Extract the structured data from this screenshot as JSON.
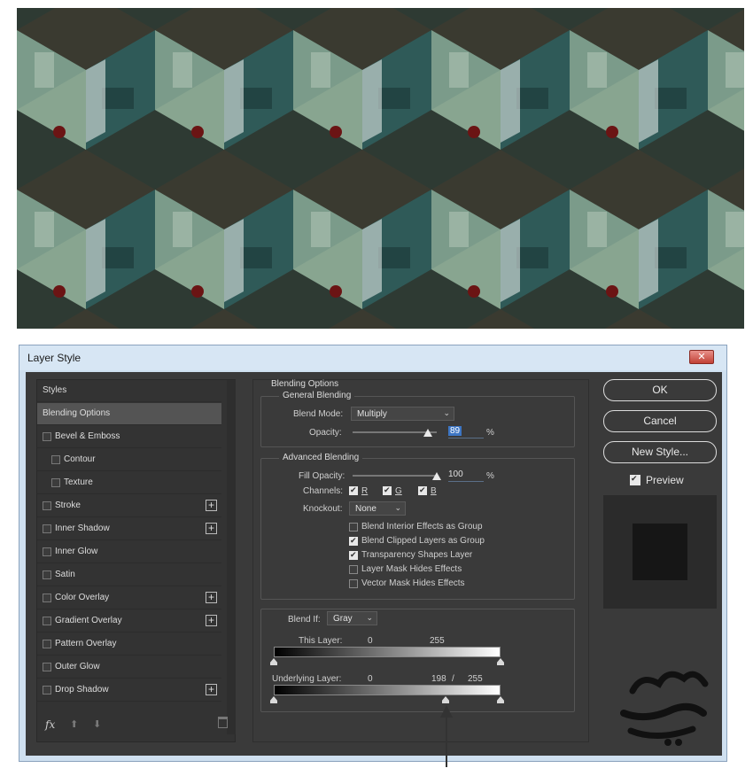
{
  "dialog": {
    "title": "Layer Style",
    "close_glyph": "✕"
  },
  "styles_list": {
    "items": [
      {
        "label": "Styles",
        "checkbox": false,
        "plus": false,
        "active": false,
        "indent": false
      },
      {
        "label": "Blending Options",
        "checkbox": false,
        "plus": false,
        "active": true,
        "indent": false
      },
      {
        "label": "Bevel & Emboss",
        "checkbox": true,
        "plus": false,
        "active": false,
        "indent": false
      },
      {
        "label": "Contour",
        "checkbox": true,
        "plus": false,
        "active": false,
        "indent": true
      },
      {
        "label": "Texture",
        "checkbox": true,
        "plus": false,
        "active": false,
        "indent": true
      },
      {
        "label": "Stroke",
        "checkbox": true,
        "plus": true,
        "active": false,
        "indent": false
      },
      {
        "label": "Inner Shadow",
        "checkbox": true,
        "plus": true,
        "active": false,
        "indent": false
      },
      {
        "label": "Inner Glow",
        "checkbox": true,
        "plus": false,
        "active": false,
        "indent": false
      },
      {
        "label": "Satin",
        "checkbox": true,
        "plus": false,
        "active": false,
        "indent": false
      },
      {
        "label": "Color Overlay",
        "checkbox": true,
        "plus": true,
        "active": false,
        "indent": false
      },
      {
        "label": "Gradient Overlay",
        "checkbox": true,
        "plus": true,
        "active": false,
        "indent": false
      },
      {
        "label": "Pattern Overlay",
        "checkbox": true,
        "plus": false,
        "active": false,
        "indent": false
      },
      {
        "label": "Outer Glow",
        "checkbox": true,
        "plus": false,
        "active": false,
        "indent": false
      },
      {
        "label": "Drop Shadow",
        "checkbox": true,
        "plus": true,
        "active": false,
        "indent": false
      }
    ],
    "footer": {
      "fx": "fx",
      "up": "⬆",
      "down": "⬇"
    }
  },
  "blending": {
    "section_title": "Blending Options",
    "general_title": "General Blending",
    "blend_mode_label": "Blend Mode:",
    "blend_mode_value": "Multiply",
    "opacity_label": "Opacity:",
    "opacity_value": "89",
    "opacity_fraction": 0.89,
    "percent": "%",
    "advanced_title": "Advanced Blending",
    "fill_opacity_label": "Fill Opacity:",
    "fill_opacity_value": "100",
    "fill_opacity_fraction": 1.0,
    "channels_label": "Channels:",
    "channels": [
      {
        "label": "R",
        "checked": true
      },
      {
        "label": "G",
        "checked": true
      },
      {
        "label": "B",
        "checked": true
      }
    ],
    "knockout_label": "Knockout:",
    "knockout_value": "None",
    "options": [
      {
        "label": "Blend Interior Effects as Group",
        "checked": false
      },
      {
        "label": "Blend Clipped Layers as Group",
        "checked": true
      },
      {
        "label": "Transparency Shapes Layer",
        "checked": true
      },
      {
        "label": "Layer Mask Hides Effects",
        "checked": false
      },
      {
        "label": "Vector Mask Hides Effects",
        "checked": false
      }
    ],
    "blend_if_label": "Blend If:",
    "blend_if_value": "Gray",
    "this_layer_label": "This Layer:",
    "this_layer_low": "0",
    "this_layer_high": "255",
    "underlying_label": "Underlying Layer:",
    "underlying_low": "0",
    "underlying_split": "198",
    "underlying_sep": "/",
    "underlying_high": "255"
  },
  "buttons": {
    "ok": "OK",
    "cancel": "Cancel",
    "new_style": "New Style...",
    "preview_label": "Preview",
    "preview_checked": true
  }
}
